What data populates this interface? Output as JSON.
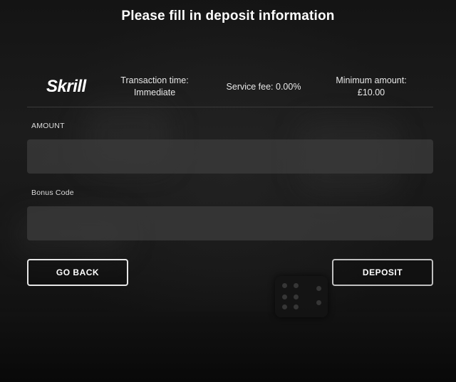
{
  "page": {
    "title": "Please fill in deposit information"
  },
  "method": {
    "logo_text": "Skrill",
    "transaction_time_label": "Transaction time:",
    "transaction_time_value": "Immediate",
    "service_fee": "Service fee: 0.00%",
    "minimum_amount_label": "Minimum amount:",
    "minimum_amount_value": "£10.00"
  },
  "form": {
    "amount_label": "AMOUNT",
    "amount_value": "",
    "bonus_label": "Bonus Code",
    "bonus_value": ""
  },
  "actions": {
    "back_label": "GO BACK",
    "deposit_label": "DEPOSIT"
  },
  "colors": {
    "background": "#151515",
    "input_fill": "#3c3c3c",
    "text": "#ffffff",
    "border": "#e6e6e6"
  }
}
